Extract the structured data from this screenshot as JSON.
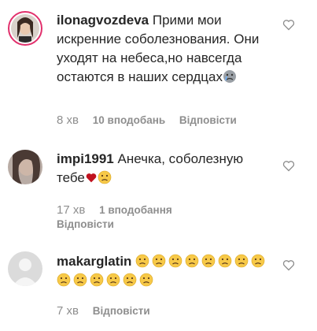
{
  "comments": [
    {
      "username": "ilonagvozdeva",
      "text": "Прими мои искренние соболезнования. Они уходят на небеса,но навсегда остаются в наших сердцах",
      "time": "8 хв",
      "likes": "10 вподобань",
      "reply_label": "Відповісти"
    },
    {
      "username": "impi1991",
      "text": "Анечка, соболезную тебе",
      "time": "17 хв",
      "likes": "1 вподобання",
      "reply_label": "Відповісти"
    },
    {
      "username": "makarglatin",
      "text": "",
      "time": "7 хв",
      "likes": "",
      "reply_label": "Відповісти",
      "emoji_count": 14
    }
  ],
  "icons": {
    "like": "heart-outline-icon",
    "sad_face": "frowning-face-emoji",
    "red_heart": "red-heart-emoji",
    "praying": "crying-face-emoji"
  },
  "colors": {
    "text": "#262626",
    "secondary": "#8e8e8e",
    "story_ring": "#e1306c",
    "emoji_yellow": "#f7c948",
    "heart_red": "#c0121f"
  }
}
